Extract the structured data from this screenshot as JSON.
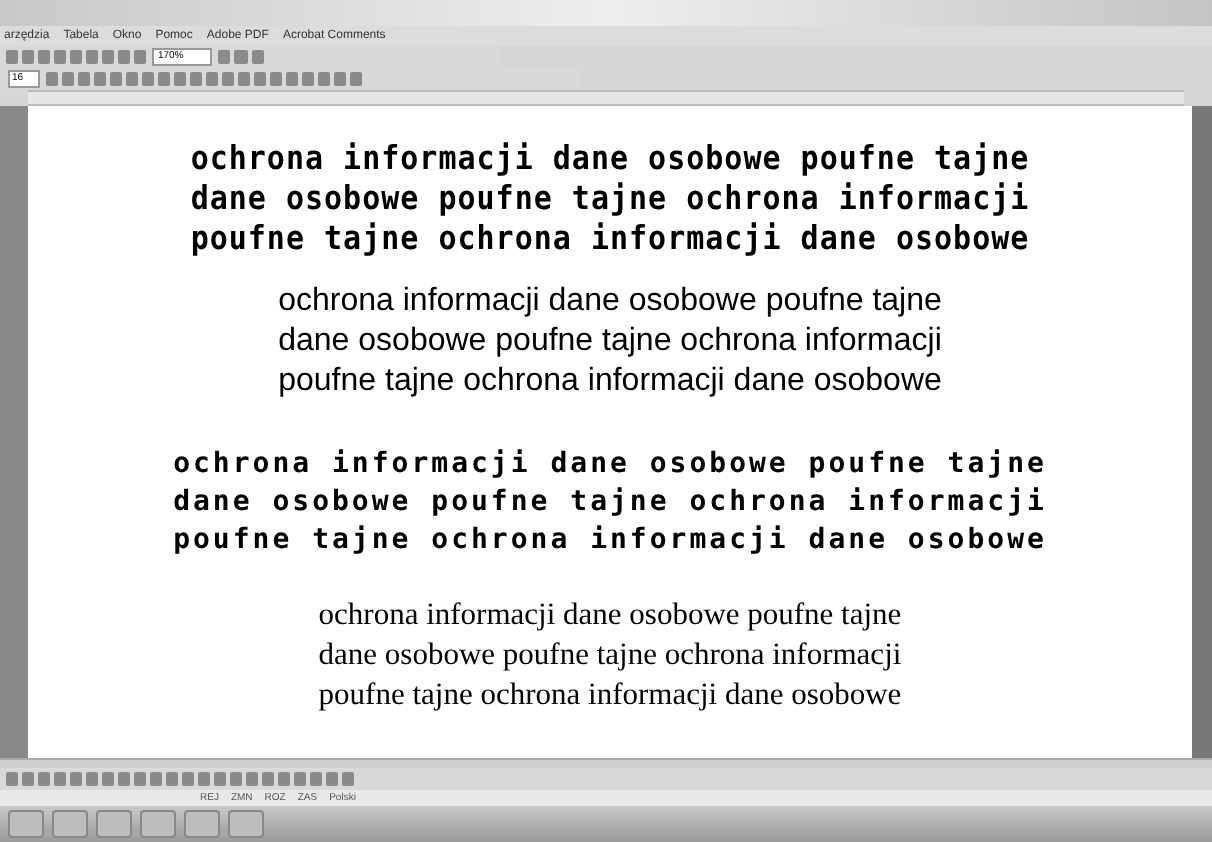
{
  "menu": [
    "arzędzia",
    "Tabela",
    "Okno",
    "Pomoc",
    "Adobe PDF",
    "Acrobat Comments"
  ],
  "toolbar": {
    "zoom": "170%",
    "font_size": "16"
  },
  "document": {
    "blocks": [
      {
        "kind": "decorative",
        "lines": [
          "ochrona informacji dane osobowe poufne tajne",
          "dane osobowe poufne tajne ochrona informacji",
          "poufne tajne ochrona informacji dane osobowe"
        ]
      },
      {
        "kind": "sans",
        "lines": [
          "ochrona informacji dane osobowe poufne tajne",
          "dane osobowe poufne tajne ochrona informacji",
          "poufne tajne ochrona informacji dane osobowe"
        ]
      },
      {
        "kind": "blocky",
        "lines": [
          "ochrona informacji dane osobowe poufne tajne",
          "dane osobowe poufne tajne ochrona informacji",
          "poufne tajne ochrona informacji dane osobowe"
        ]
      },
      {
        "kind": "serif",
        "lines": [
          "ochrona informacji dane osobowe poufne tajne",
          "dane osobowe poufne tajne ochrona informacji",
          "poufne tajne ochrona informacji dane osobowe"
        ]
      }
    ]
  },
  "status_bar": [
    "REJ",
    "ZMN",
    "ROZ",
    "ZAS",
    "Polski"
  ]
}
